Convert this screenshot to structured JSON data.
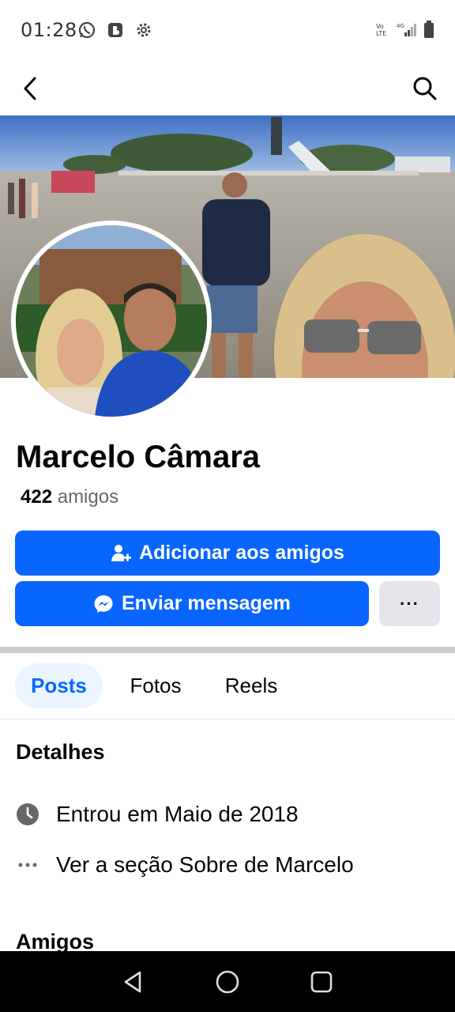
{
  "status_bar": {
    "time": "01:28",
    "left_icons": [
      "whatsapp-icon",
      "b-app-icon",
      "settings-icon"
    ],
    "right_icons": [
      "volte-icon",
      "signal-4g-icon",
      "battery-icon"
    ]
  },
  "topbar": {
    "back_icon": "chevron-left-icon",
    "search_icon": "search-icon"
  },
  "profile": {
    "name": "Marcelo Câmara",
    "friends_count": "422",
    "friends_label": "amigos"
  },
  "actions": {
    "add_friend_label": "Adicionar aos amigos",
    "add_friend_icon": "person-add-icon",
    "message_label": "Enviar mensagem",
    "message_icon": "messenger-icon",
    "more_label": "···"
  },
  "tabs": [
    {
      "label": "Posts",
      "active": true
    },
    {
      "label": "Fotos",
      "active": false
    },
    {
      "label": "Reels",
      "active": false
    }
  ],
  "details": {
    "title": "Detalhes",
    "joined": "Entrou em Maio de 2018",
    "joined_icon": "clock-icon",
    "about": "Ver a seção Sobre de Marcelo",
    "about_icon": "more-dots-icon"
  },
  "friends_section": {
    "title": "Amigos"
  },
  "colors": {
    "accent": "#0866ff",
    "secondary_button": "#e4e6eb",
    "active_tab_bg": "#ebf5ff",
    "muted_text": "#65676b"
  },
  "navbar": {
    "icons": [
      "nav-back-icon",
      "nav-home-icon",
      "nav-recents-icon"
    ]
  }
}
